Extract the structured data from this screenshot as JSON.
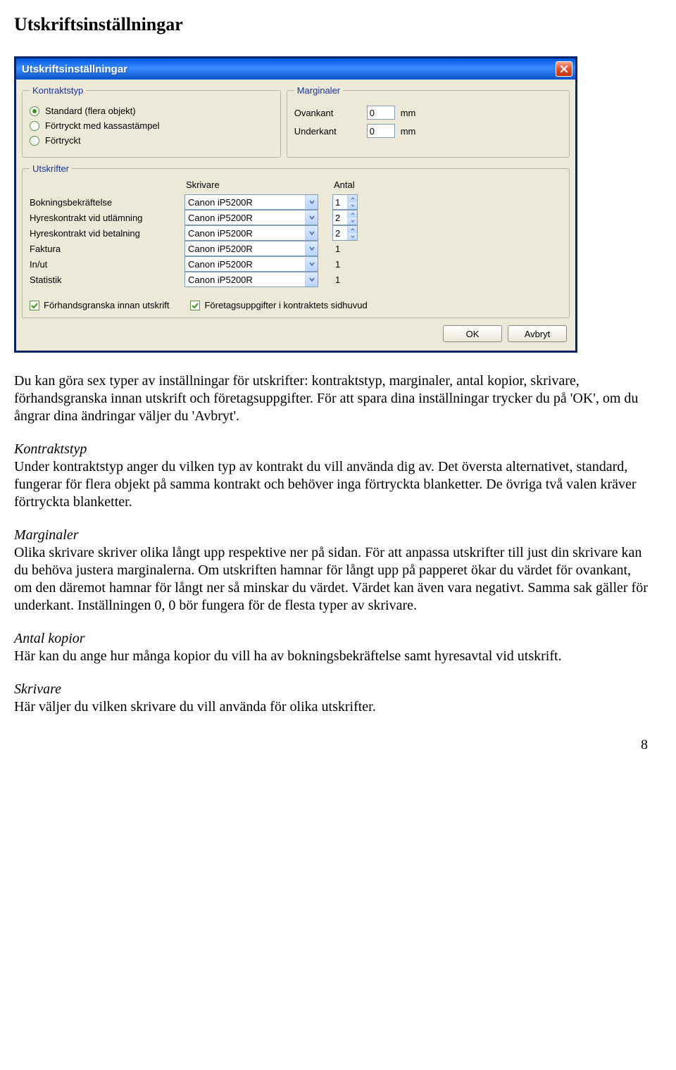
{
  "page_title": "Utskriftsinställningar",
  "dialog": {
    "title": "Utskriftsinställningar",
    "kontraktstyp_legend": "Kontraktstyp",
    "marginaler_legend": "Marginaler",
    "utskrifter_legend": "Utskrifter",
    "radios": [
      {
        "label": "Standard (flera objekt)",
        "checked": true
      },
      {
        "label": "Förtryckt med kassastämpel",
        "checked": false
      },
      {
        "label": "Förtryckt",
        "checked": false
      }
    ],
    "margins": {
      "ovankant_label": "Ovankant",
      "ovankant_value": "0",
      "underkant_label": "Underkant",
      "underkant_value": "0",
      "unit": "mm"
    },
    "print_headers": {
      "skrivare": "Skrivare",
      "antal": "Antal"
    },
    "print_rows": [
      {
        "label": "Bokningsbekräftelse",
        "printer": "Canon iP5200R",
        "count": "1",
        "spinner": true
      },
      {
        "label": "Hyreskontrakt vid utlämning",
        "printer": "Canon iP5200R",
        "count": "2",
        "spinner": true
      },
      {
        "label": "Hyreskontrakt vid betalning",
        "printer": "Canon iP5200R",
        "count": "2",
        "spinner": true
      },
      {
        "label": "Faktura",
        "printer": "Canon iP5200R",
        "count": "1",
        "spinner": false
      },
      {
        "label": "In/ut",
        "printer": "Canon iP5200R",
        "count": "1",
        "spinner": false
      },
      {
        "label": "Statistik",
        "printer": "Canon iP5200R",
        "count": "1",
        "spinner": false
      }
    ],
    "checks": [
      {
        "label": "Förhandsgranska innan utskrift",
        "checked": true
      },
      {
        "label": "Företagsuppgifter i kontraktets sidhuvud",
        "checked": true
      }
    ],
    "ok_label": "OK",
    "avbryt_label": "Avbryt"
  },
  "paragraphs": {
    "intro": "Du kan göra sex typer av inställningar för utskrifter: kontraktstyp, marginaler, antal kopior, skrivare, förhandsgranska innan utskrift och företagsuppgifter. För att spara dina inställningar trycker du på 'OK', om du ångrar dina ändringar väljer du 'Avbryt'.",
    "kontraktstyp_h": "Kontraktstyp",
    "kontraktstyp": "Under kontraktstyp anger du vilken typ av kontrakt du vill använda dig av. Det översta alternativet, standard, fungerar för flera objekt på samma kontrakt och behöver inga förtryckta blanketter. De övriga två valen kräver förtryckta blanketter.",
    "marginaler_h": "Marginaler",
    "marginaler": "Olika skrivare skriver olika långt upp respektive ner på sidan. För att anpassa utskrifter till just din skrivare kan du behöva justera marginalerna. Om utskriften hamnar för långt upp på papperet ökar du värdet för ovankant, om den däremot hamnar för långt ner så minskar du värdet. Värdet kan även vara negativt. Samma sak gäller för underkant. Inställningen 0, 0 bör fungera för de flesta typer av skrivare.",
    "antal_h": "Antal kopior",
    "antal": "Här kan du ange hur många kopior du vill ha av bokningsbekräftelse samt hyresavtal vid utskrift.",
    "skrivare_h": "Skrivare",
    "skrivare": "Här väljer du vilken skrivare du vill använda för olika utskrifter."
  },
  "page_number": "8"
}
